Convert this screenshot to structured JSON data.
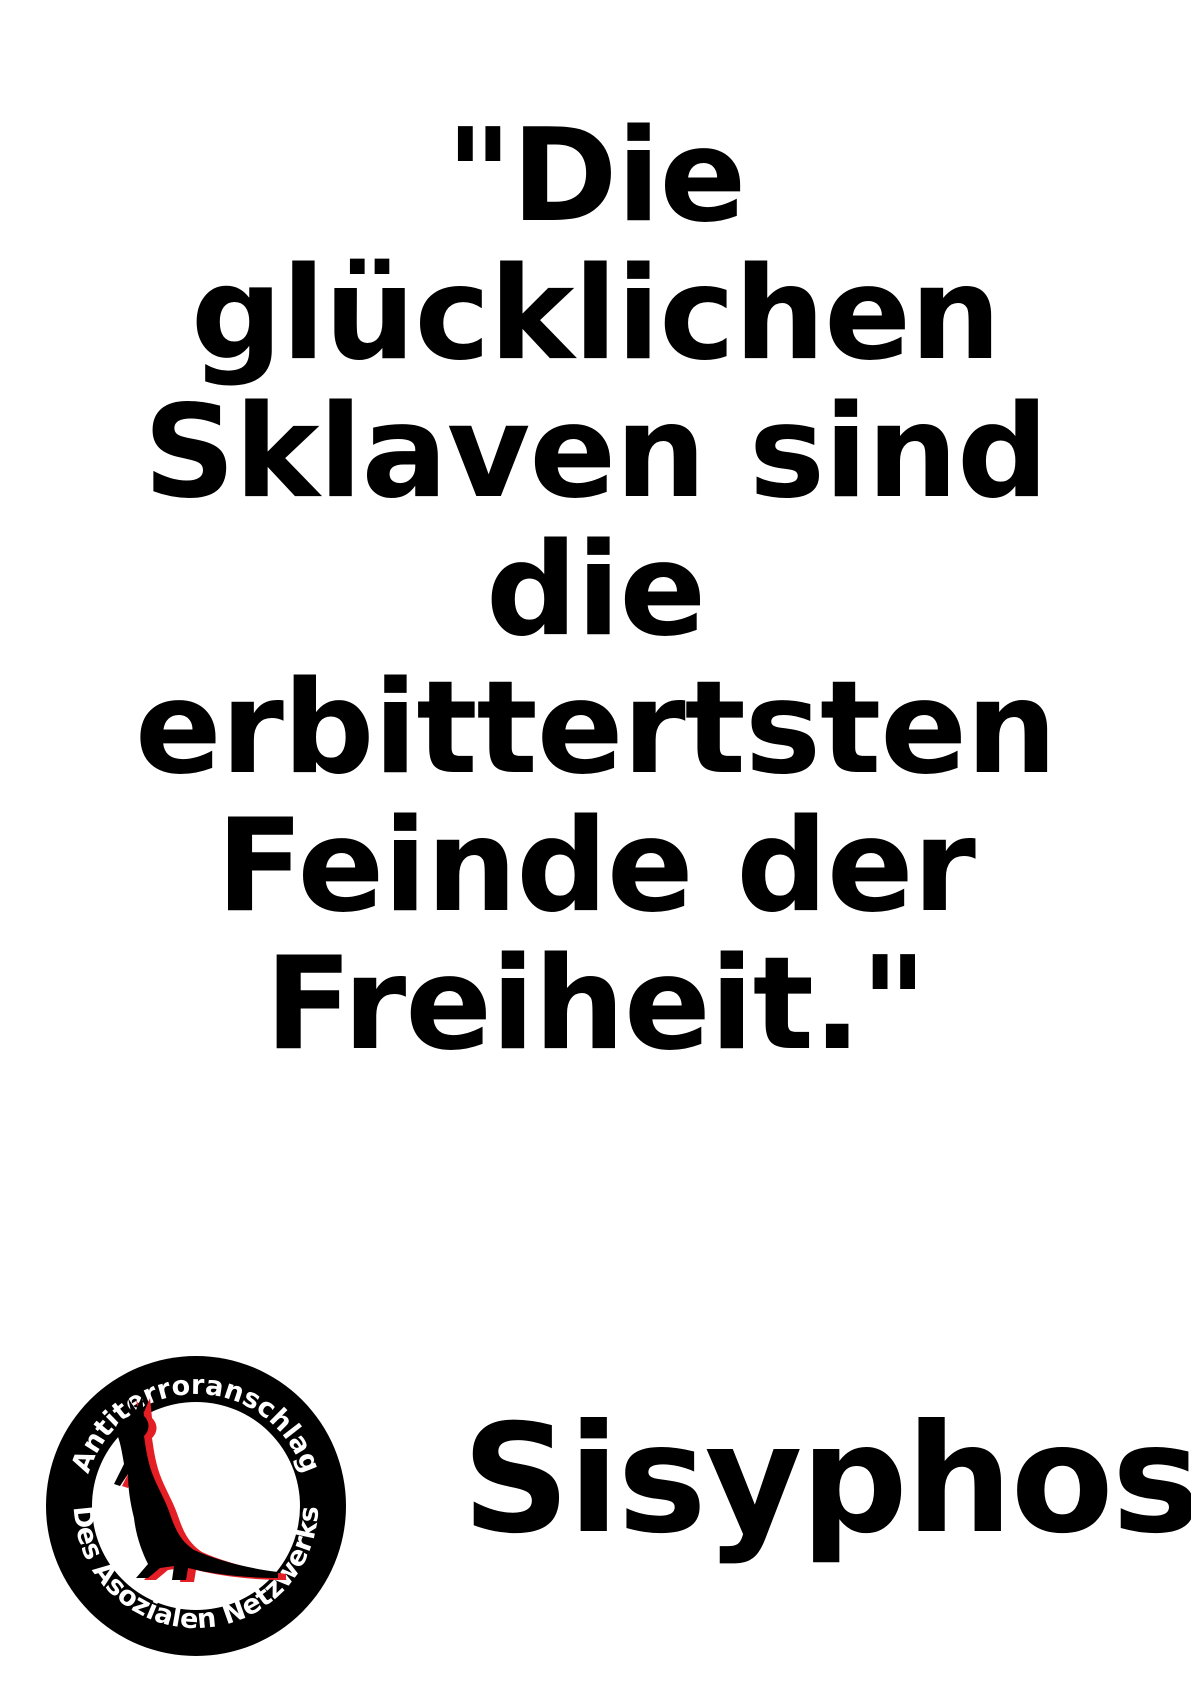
{
  "quote": {
    "lines": [
      "\"Die",
      "glücklichen",
      "Sklaven sind",
      "die",
      "erbittertsten",
      "Feinde der",
      "Freiheit.\""
    ]
  },
  "author": "Sisyphos",
  "logo": {
    "top_text": "Antiterroranschlag",
    "bottom_text": "Des Asozialen Netzwerks",
    "icon": "kangaroo-icon",
    "colors": {
      "ring": "#000000",
      "silhouette": "#000000",
      "shadow": "#e31e24",
      "text": "#ffffff"
    }
  }
}
